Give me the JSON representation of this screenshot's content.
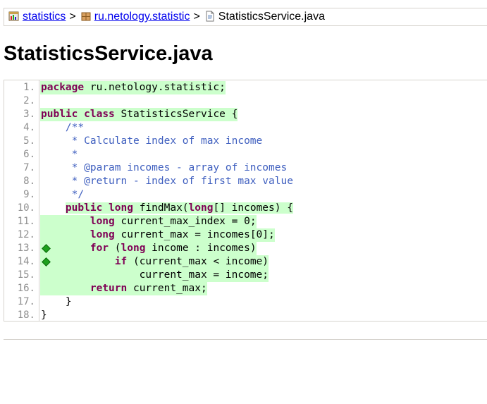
{
  "breadcrumb": {
    "project": "statistics",
    "sep1": ">",
    "package": "ru.netology.statistic",
    "sep2": ">",
    "file": "StatisticsService.java"
  },
  "title": "StatisticsService.java",
  "source": {
    "line_numbers": [
      "1.",
      "2.",
      "3.",
      "4.",
      "5.",
      "6.",
      "7.",
      "8.",
      "9.",
      "10.",
      "11.",
      "12.",
      "13.",
      "14.",
      "15.",
      "16.",
      "17.",
      "18."
    ],
    "lines": {
      "l1_kw": "package",
      "l1_rest": " ru.netology.statistic;",
      "l3_kw1": "public",
      "l3_kw2": "class",
      "l3_rest": " StatisticsService {",
      "l4": "    /**",
      "l5": "     * Calculate index of max income",
      "l6": "     *",
      "l7": "     * @param incomes - array of incomes",
      "l8": "     * @return - index of first max value",
      "l9": "     */",
      "l10_pre": "    ",
      "l10_kw1": "public",
      "l10_kw2": "long",
      "l10_mid": " findMax(",
      "l10_kw3": "long",
      "l10_rest": "[] incomes) {",
      "l11_pre": "        ",
      "l11_kw": "long",
      "l11_rest": " current_max_index = 0;",
      "l12_pre": "        ",
      "l12_kw": "long",
      "l12_rest": " current_max = incomes[0];",
      "l13_pre": "        ",
      "l13_kw1": "for",
      "l13_mid": " (",
      "l13_kw2": "long",
      "l13_rest": " income : incomes)",
      "l14_pre": "            ",
      "l14_kw": "if",
      "l14_rest": " (current_max < income)",
      "l15": "                current_max = income;",
      "l16_pre": "        ",
      "l16_kw": "return",
      "l16_rest": " current_max;",
      "l17": "    }",
      "l18": "}"
    }
  },
  "colors": {
    "covered_bg": "#ccffcc",
    "keyword": "#7f0055",
    "comment": "#3f5fbf",
    "branch_marker": "#1da01d"
  }
}
